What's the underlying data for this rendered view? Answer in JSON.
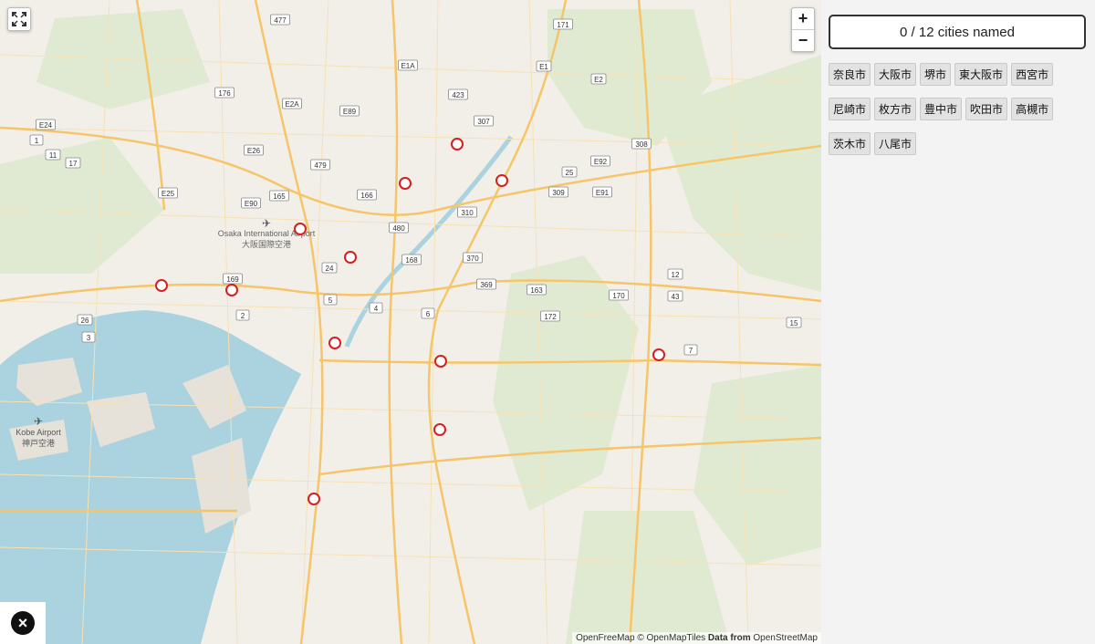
{
  "score_text": "0 / 12 cities named",
  "cities": [
    "奈良市",
    "大阪市",
    "堺市",
    "東大阪市",
    "西宮市",
    "尼崎市",
    "枚方市",
    "豊中市",
    "吹田市",
    "高槻市",
    "茨木市",
    "八尾市"
  ],
  "map": {
    "airport_labels": [
      "Osaka International Airport",
      "大阪国際空港",
      "Kobe Airport",
      "神戸空港"
    ],
    "road_labels": [
      "477",
      "171",
      "E1A",
      "E1",
      "176",
      "E2",
      "E2A",
      "423",
      "E89",
      "307",
      "E24",
      "1",
      "11",
      "E26",
      "17",
      "308",
      "479",
      "E92",
      "E25",
      "25",
      "165",
      "166",
      "E91",
      "E90",
      "309",
      "310",
      "480",
      "168",
      "24",
      "169",
      "370",
      "369",
      "163",
      "170",
      "12",
      "43",
      "2",
      "5",
      "4",
      "6",
      "26",
      "15",
      "172",
      "3",
      "7"
    ],
    "attribution_openfree": "OpenFreeMap",
    "attribution_omt": "© OpenMapTiles",
    "attribution_data": "Data from",
    "attribution_osm": "OpenStreetMap",
    "zoom_in": "+",
    "zoom_out": "−",
    "colors": {
      "water": "#aad3df",
      "land": "#f2efe9",
      "marker": "#d32020",
      "motorway": "#f6c56a"
    }
  },
  "close_icon": "×"
}
